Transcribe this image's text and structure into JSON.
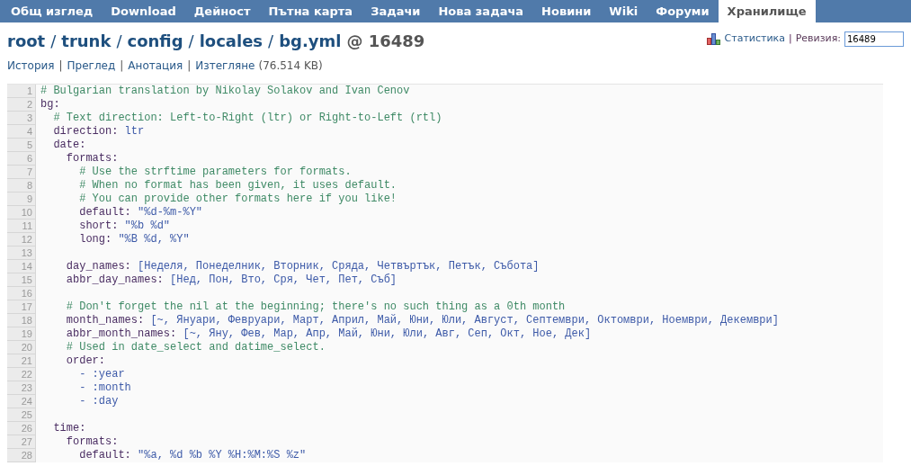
{
  "tabs": [
    {
      "label": "Общ изглед",
      "selected": false
    },
    {
      "label": "Download",
      "selected": false
    },
    {
      "label": "Дейност",
      "selected": false
    },
    {
      "label": "Пътна карта",
      "selected": false
    },
    {
      "label": "Задачи",
      "selected": false
    },
    {
      "label": "Нова задача",
      "selected": false
    },
    {
      "label": "Новини",
      "selected": false
    },
    {
      "label": "Wiki",
      "selected": false
    },
    {
      "label": "Форуми",
      "selected": false
    },
    {
      "label": "Хранилище",
      "selected": true
    }
  ],
  "breadcrumb": {
    "parts": [
      "root",
      "trunk",
      "config",
      "locales",
      "bg.yml"
    ],
    "separator": "/",
    "revision": "@ 16489"
  },
  "revision_bar": {
    "statistics_link": "Статистика",
    "separator": "|",
    "revision_label": "Ревизия:",
    "revision_value": "16489"
  },
  "file_links": {
    "links": [
      "История",
      "Преглед",
      "Анотация",
      "Изтегляне"
    ],
    "separator": "|",
    "size": "(76.514 KB)"
  },
  "code_lines": [
    {
      "no": "1",
      "tokens": [
        {
          "kind": "comment",
          "text": "# Bulgarian translation by Nikolay Solakov and Ivan Cenov"
        }
      ]
    },
    {
      "no": "2",
      "tokens": [
        {
          "kind": "key",
          "text": "bg:"
        }
      ]
    },
    {
      "no": "3",
      "tokens": [
        {
          "kind": "comment",
          "text": "  # Text direction: Left-to-Right (ltr) or Right-to-Left (rtl)"
        }
      ]
    },
    {
      "no": "4",
      "tokens": [
        {
          "kind": "key",
          "text": "  direction:"
        },
        {
          "kind": "value",
          "text": " ltr"
        }
      ]
    },
    {
      "no": "5",
      "tokens": [
        {
          "kind": "key",
          "text": "  date:"
        }
      ]
    },
    {
      "no": "6",
      "tokens": [
        {
          "kind": "key",
          "text": "    formats:"
        }
      ]
    },
    {
      "no": "7",
      "tokens": [
        {
          "kind": "comment",
          "text": "      # Use the strftime parameters for formats."
        }
      ]
    },
    {
      "no": "8",
      "tokens": [
        {
          "kind": "comment",
          "text": "      # When no format has been given, it uses default."
        }
      ]
    },
    {
      "no": "9",
      "tokens": [
        {
          "kind": "comment",
          "text": "      # You can provide other formats here if you like!"
        }
      ]
    },
    {
      "no": "10",
      "tokens": [
        {
          "kind": "key",
          "text": "      default:"
        },
        {
          "kind": "value",
          "text": " \"%d-%m-%Y\""
        }
      ]
    },
    {
      "no": "11",
      "tokens": [
        {
          "kind": "key",
          "text": "      short:"
        },
        {
          "kind": "value",
          "text": " \"%b %d\""
        }
      ]
    },
    {
      "no": "12",
      "tokens": [
        {
          "kind": "key",
          "text": "      long:"
        },
        {
          "kind": "value",
          "text": " \"%B %d, %Y\""
        }
      ]
    },
    {
      "no": "13"
    },
    {
      "no": "14",
      "tokens": [
        {
          "kind": "key",
          "text": "    day_names:"
        },
        {
          "kind": "value",
          "text": " [Неделя, Понеделник, Вторник, Сряда, Четвъртък, Петък, Събота]"
        }
      ]
    },
    {
      "no": "15",
      "tokens": [
        {
          "kind": "key",
          "text": "    abbr_day_names:"
        },
        {
          "kind": "value",
          "text": " [Нед, Пон, Вто, Сря, Чет, Пет, Съб]"
        }
      ]
    },
    {
      "no": "16"
    },
    {
      "no": "17",
      "tokens": [
        {
          "kind": "comment",
          "text": "    # Don't forget the nil at the beginning; there's no such thing as a 0th month"
        }
      ]
    },
    {
      "no": "18",
      "tokens": [
        {
          "kind": "key",
          "text": "    month_names:"
        },
        {
          "kind": "value",
          "text": " [~, Януари, Февруари, Март, Април, Май, Юни, Юли, Август, Септември, Октомври, Ноември, Декември]"
        }
      ]
    },
    {
      "no": "19",
      "tokens": [
        {
          "kind": "key",
          "text": "    abbr_month_names:"
        },
        {
          "kind": "value",
          "text": " [~, Яну, Фев, Мар, Апр, Май, Юни, Юли, Авг, Сеп, Окт, Ное, Дек]"
        }
      ]
    },
    {
      "no": "20",
      "tokens": [
        {
          "kind": "comment",
          "text": "    # Used in date_select and datime_select."
        }
      ]
    },
    {
      "no": "21",
      "tokens": [
        {
          "kind": "key",
          "text": "    order:"
        }
      ]
    },
    {
      "no": "22",
      "tokens": [
        {
          "kind": "value",
          "text": "      - :year"
        }
      ]
    },
    {
      "no": "23",
      "tokens": [
        {
          "kind": "value",
          "text": "      - :month"
        }
      ]
    },
    {
      "no": "24",
      "tokens": [
        {
          "kind": "value",
          "text": "      - :day"
        }
      ]
    },
    {
      "no": "25"
    },
    {
      "no": "26",
      "tokens": [
        {
          "kind": "key",
          "text": "  time:"
        }
      ]
    },
    {
      "no": "27",
      "tokens": [
        {
          "kind": "key",
          "text": "    formats:"
        }
      ]
    },
    {
      "no": "28",
      "tokens": [
        {
          "kind": "key",
          "text": "      default:"
        },
        {
          "kind": "value",
          "text": " \"%a, %d %b %Y %H:%M:%S %z\""
        }
      ]
    }
  ]
}
